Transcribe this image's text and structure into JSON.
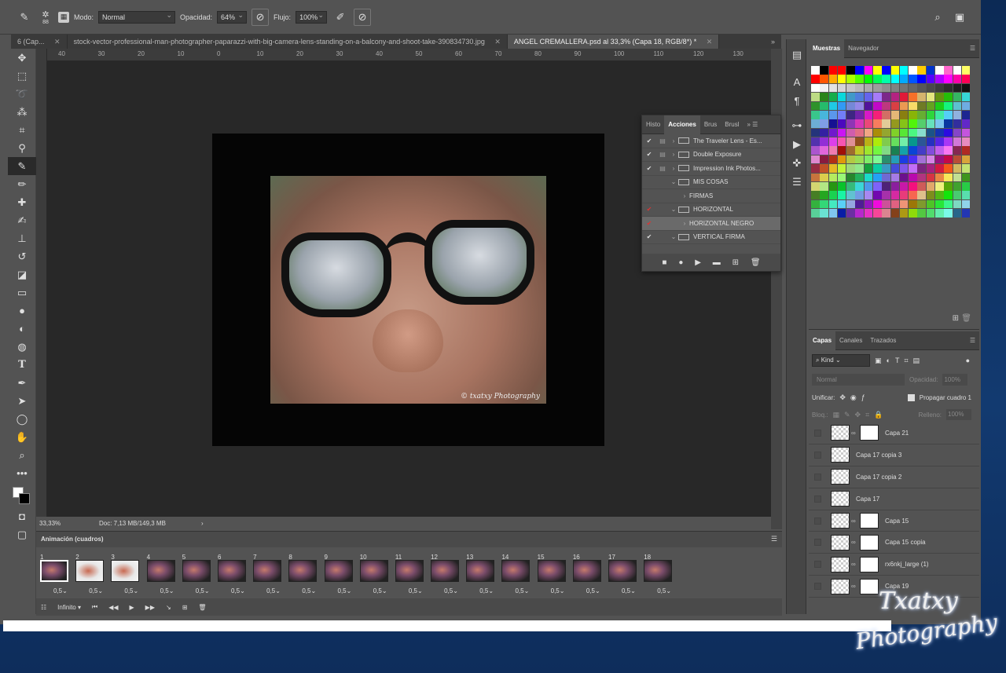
{
  "options_bar": {
    "brush_size": "88",
    "mode_label": "Modo:",
    "mode_value": "Normal",
    "opacity_label": "Opacidad:",
    "opacity_value": "64%",
    "flow_label": "Flujo:",
    "flow_value": "100%"
  },
  "tabs": [
    {
      "label": "6 (Cap..."
    },
    {
      "label": "stock-vector-professional-man-photographer-paparazzi-with-big-camera-lens-standing-on-a-balcony-and-shoot-take-390834730.jpg"
    },
    {
      "label": "ANGEL CREMALLERA.psd al 33,3% (Capa 18, RGB/8*) *"
    }
  ],
  "ruler_h": [
    "40",
    "30",
    "20",
    "10",
    "0",
    "10",
    "20",
    "30",
    "40",
    "50",
    "60",
    "70",
    "80",
    "90",
    "100",
    "110",
    "120",
    "130",
    "14"
  ],
  "canvas": {
    "watermark": "© txatxy Photography"
  },
  "status": {
    "zoom": "33,33%",
    "doc": "Doc: 7,13 MB/149,3 MB"
  },
  "actions_panel": {
    "tabs": [
      "Histo",
      "Acciones",
      "Brus",
      "Brusl"
    ],
    "rows": [
      {
        "check": "✔",
        "name": "The Traveler Lens - Es...",
        "red": false,
        "sel": false,
        "indent": 0,
        "folder": true
      },
      {
        "check": "✔",
        "name": "Double Exposure",
        "red": false,
        "sel": false,
        "indent": 0,
        "folder": true
      },
      {
        "check": "✔",
        "name": "Impression Ink Photos...",
        "red": false,
        "sel": false,
        "indent": 0,
        "folder": true
      },
      {
        "check": "",
        "name": "MIS COSAS",
        "red": false,
        "sel": false,
        "indent": 0,
        "folder": true
      },
      {
        "check": "",
        "name": "FIRMAS",
        "red": false,
        "sel": false,
        "indent": 1,
        "folder": false
      },
      {
        "check": "✔",
        "name": "HORIZONTAL",
        "red": true,
        "sel": false,
        "indent": 0,
        "folder": true
      },
      {
        "check": "✔",
        "name": "HORIZONTAL NEGRO",
        "red": true,
        "sel": true,
        "indent": 1,
        "folder": false
      },
      {
        "check": "✔",
        "name": "VERTICAL FIRMA",
        "red": false,
        "sel": false,
        "indent": 0,
        "folder": true
      }
    ]
  },
  "right_panel": {
    "swatches_tab": "Muestras",
    "navigator_tab": "Navegador",
    "layers_tabs": [
      "Capas",
      "Canales",
      "Trazados"
    ],
    "kind_label": "Kind",
    "blend_mode": "Normal",
    "opacity_label": "Opacidad:",
    "unify_label": "Unificar:",
    "propagate_label": "Propagar cuadro 1",
    "lock_label": "Bloq.:",
    "fill_label": "Relleno:",
    "fill_value": "100%",
    "opacity_value": "100%"
  },
  "layers": [
    {
      "name": "Capa 21",
      "mask": true
    },
    {
      "name": "Capa 17 copia 3",
      "mask": false
    },
    {
      "name": "Capa 17 copia 2",
      "mask": false
    },
    {
      "name": "Capa 17",
      "mask": false
    },
    {
      "name": "Capa 15",
      "mask": true
    },
    {
      "name": "Capa 15 copia",
      "mask": true
    },
    {
      "name": "rx6nkj_large (1)",
      "mask": true
    },
    {
      "name": "Capa 19",
      "mask": true
    }
  ],
  "animation": {
    "title": "Animación (cuadros)",
    "frames": [
      "1",
      "2",
      "3",
      "4",
      "5",
      "6",
      "7",
      "8",
      "9",
      "10",
      "11",
      "12",
      "13",
      "14",
      "15",
      "16",
      "17",
      "18"
    ],
    "duration": "0,5",
    "loop": "Infinito"
  },
  "watermark_big": {
    "line1": "Txatxy",
    "line2": "Photography"
  },
  "swatch_colors": [
    "#ffffff",
    "#000000",
    "#ff0000",
    "#ff0000",
    "#000000",
    "#0000ff",
    "#ff00ff",
    "#ffff00",
    "#0000ff",
    "#ffff00",
    "#00ffff",
    "#ffffff",
    "#ffcc00",
    "#0033cc",
    "#ffffff",
    "#ff66cc",
    "#ffffff",
    "#ffff66"
  ]
}
